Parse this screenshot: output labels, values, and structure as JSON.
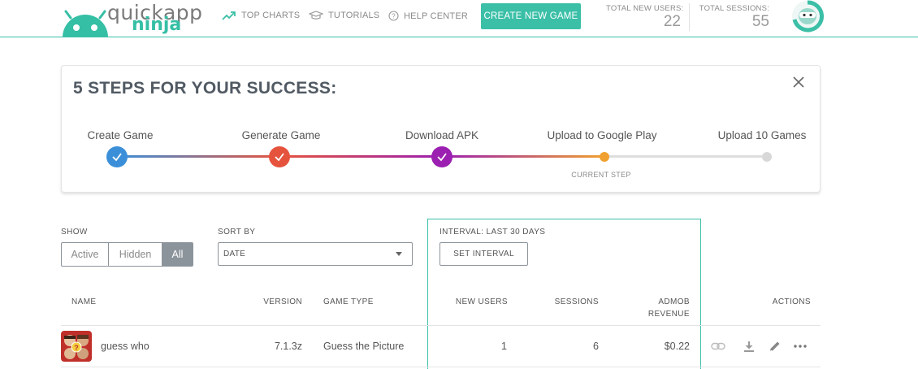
{
  "header": {
    "logo_line1": "quickapp",
    "logo_line2": "ninja",
    "nav": [
      {
        "label": "TOP CHARTS",
        "icon": "trending-up-icon"
      },
      {
        "label": "TUTORIALS",
        "icon": "graduation-cap-icon"
      },
      {
        "label": "HELP CENTER",
        "icon": "help-circle-icon"
      }
    ],
    "create_button": "CREATE NEW GAME",
    "stats": [
      {
        "label": "TOTAL NEW USERS:",
        "value": "22"
      },
      {
        "label": "TOTAL SESSIONS:",
        "value": "55"
      }
    ],
    "accent_color": "#3bbfa7"
  },
  "steps": {
    "title": "5 STEPS FOR YOUR SUCCESS:",
    "items": [
      {
        "label": "Create Game",
        "status": "done",
        "color": "#3b8fd9"
      },
      {
        "label": "Generate Game",
        "status": "done",
        "color": "#e5533d"
      },
      {
        "label": "Download APK",
        "status": "done",
        "color": "#9b1fb0"
      },
      {
        "label": "Upload to Google Play",
        "status": "current",
        "color": "#f0a030"
      },
      {
        "label": "Upload 10 Games",
        "status": "pending",
        "color": "#d8d8d8"
      }
    ],
    "current_label": "CURRENT STEP"
  },
  "filters": {
    "show_label": "SHOW",
    "show_options": [
      "Active",
      "Hidden",
      "All"
    ],
    "show_selected": "All",
    "sort_label": "SORT BY",
    "sort_value": "DATE",
    "interval_label": "INTERVAL: LAST 30 DAYS",
    "interval_button": "SET INTERVAL"
  },
  "table": {
    "headers": {
      "name": "NAME",
      "version": "VERSION",
      "game_type": "GAME TYPE",
      "new_users": "NEW USERS",
      "sessions": "SESSIONS",
      "admob_line1": "ADMOB",
      "admob_line2": "REVENUE",
      "actions": "ACTIONS"
    },
    "rows": [
      {
        "name": "guess who",
        "version": "7.1.3z",
        "game_type": "Guess the Picture",
        "new_users": "1",
        "sessions": "6",
        "revenue": "$0.22"
      }
    ]
  }
}
